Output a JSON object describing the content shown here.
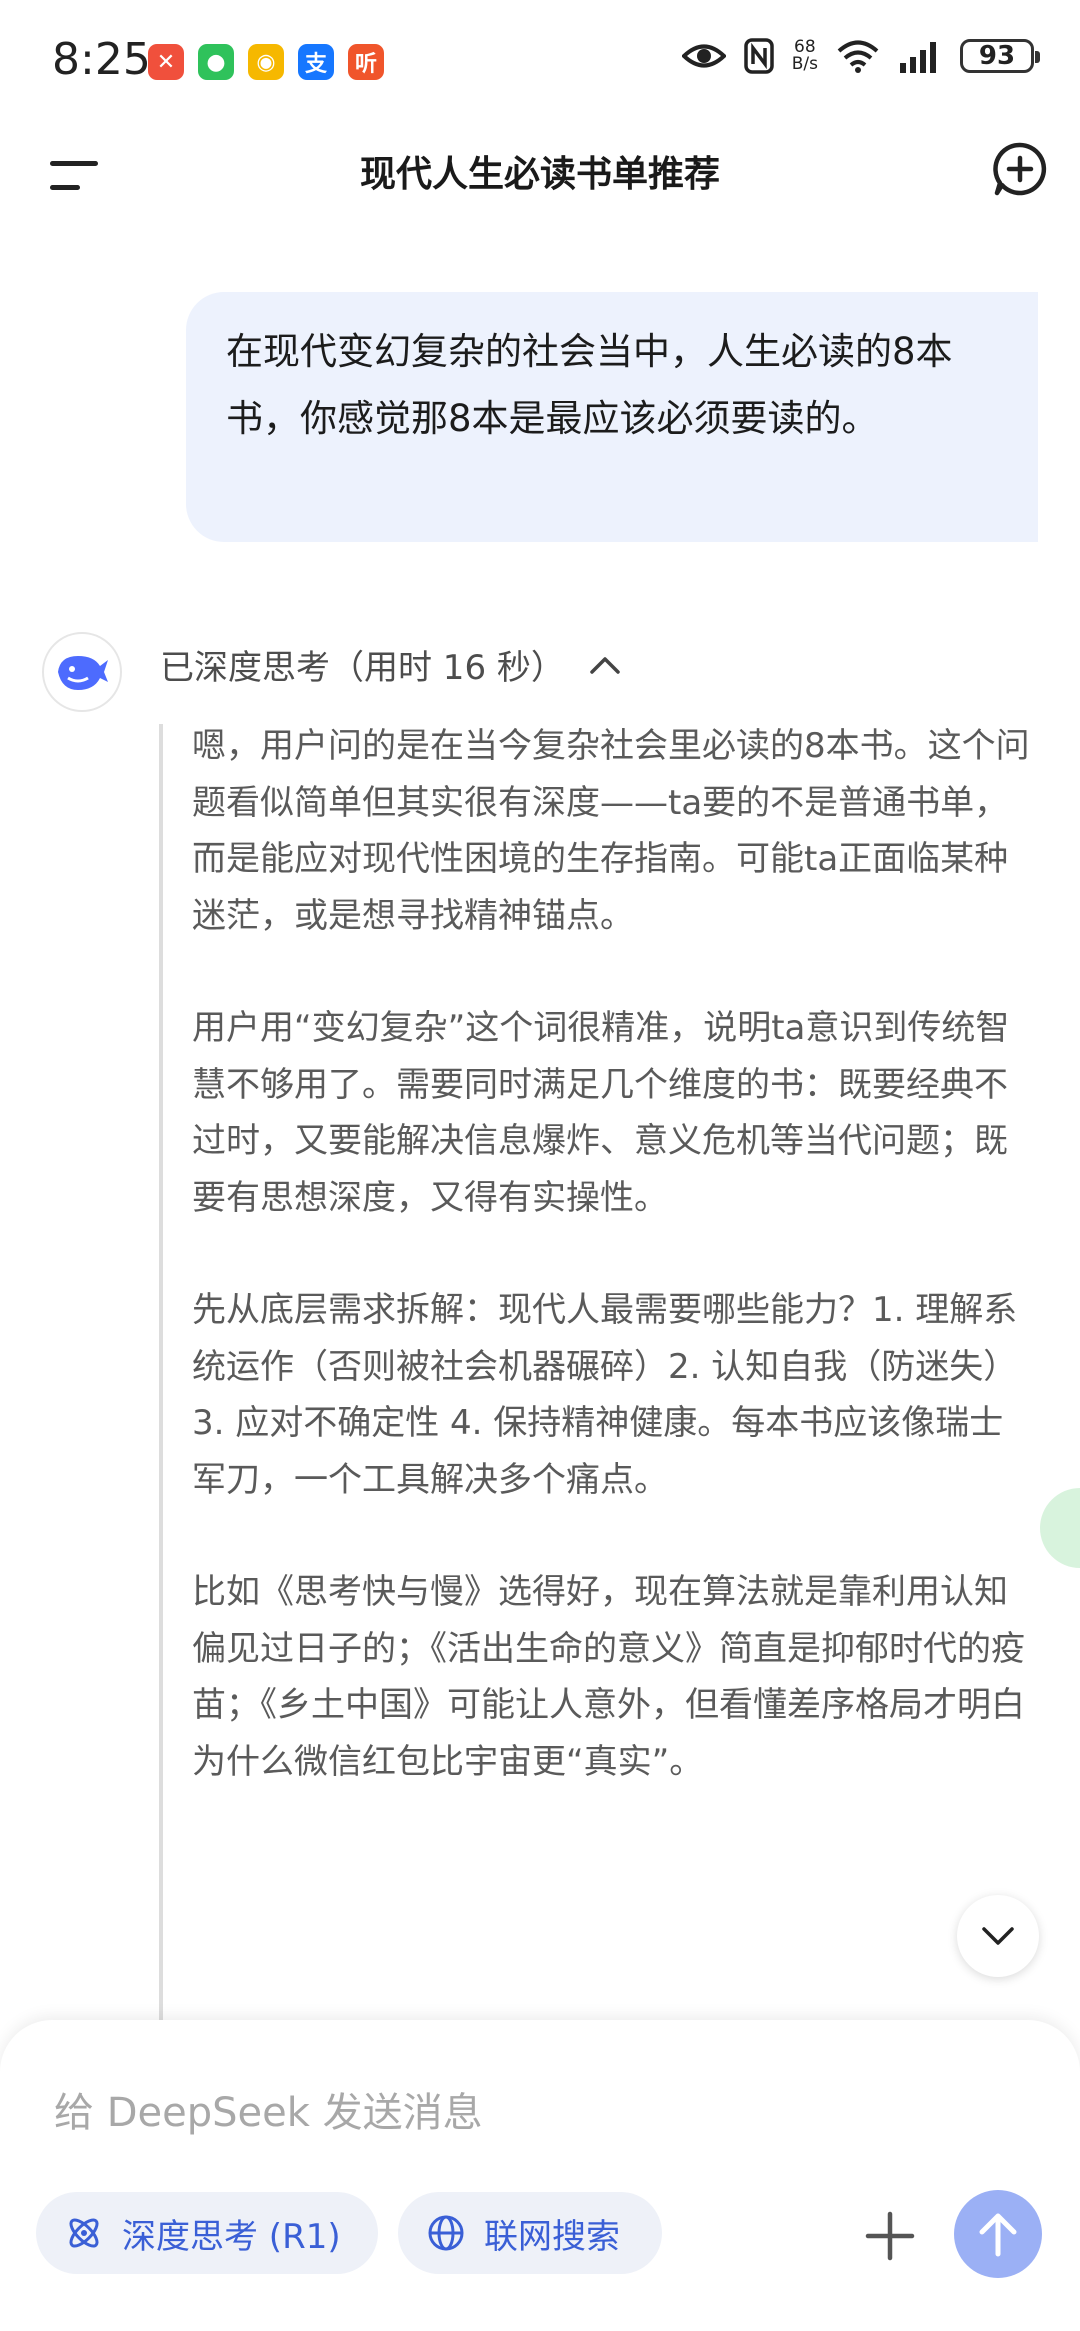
{
  "status_bar": {
    "time": "8:25",
    "net_speed_value": "68",
    "net_speed_unit": "B/s",
    "battery": "93",
    "apps": [
      {
        "icon": "baidu-netdisk-icon",
        "glyph": "✕",
        "color": "#f0503c"
      },
      {
        "icon": "wechat-icon",
        "glyph": "●",
        "color": "#2fc25b"
      },
      {
        "icon": "weibo-icon",
        "glyph": "◉",
        "color": "#f6b800"
      },
      {
        "icon": "alipay-icon",
        "glyph": "支",
        "color": "#1677ff"
      },
      {
        "icon": "ting-icon",
        "glyph": "听",
        "color": "#f0552b"
      }
    ]
  },
  "header": {
    "title": "现代人生必读书单推荐"
  },
  "conversation": {
    "user_message": "在现代变幻复杂的社会当中，人生必读的8本书，你感觉那8本是最应该必须要读的。",
    "assistant": {
      "thinking_label": "已深度思考（用时 16 秒）",
      "thinking_paragraphs": [
        "嗯，用户问的是在当今复杂社会里必读的8本书。这个问题看似简单但其实很有深度——ta要的不是普通书单，而是能应对现代性困境的生存指南。可能ta正面临某种迷茫，或是想寻找精神锚点。",
        "用户用“变幻复杂”这个词很精准，说明ta意识到传统智慧不够用了。需要同时满足几个维度的书：既要经典不过时，又要能解决信息爆炸、意义危机等当代问题；既要有思想深度，又得有实操性。",
        "先从底层需求拆解：现代人最需要哪些能力？1. 理解系统运作（否则被社会机器碾碎）2. 认知自我（防迷失）3. 应对不确定性 4. 保持精神健康。每本书应该像瑞士军刀，一个工具解决多个痛点。",
        "比如《思考快与慢》选得好，现在算法就是靠利用认知偏见过日子的；《活出生命的意义》简直是抑郁时代的疫苗；《乡土中国》可能让人意外，但看懂差序格局才明白为什么微信红包比宇宙更“真实”。"
      ]
    }
  },
  "composer": {
    "placeholder": "给 DeepSeek 发送消息",
    "deep_think_label": "深度思考 (R1)",
    "web_search_label": "联网搜索"
  },
  "colors": {
    "accent": "#3a5fd6",
    "user_bubble": "#edf2fd",
    "send_button": "#9bb0f5"
  }
}
